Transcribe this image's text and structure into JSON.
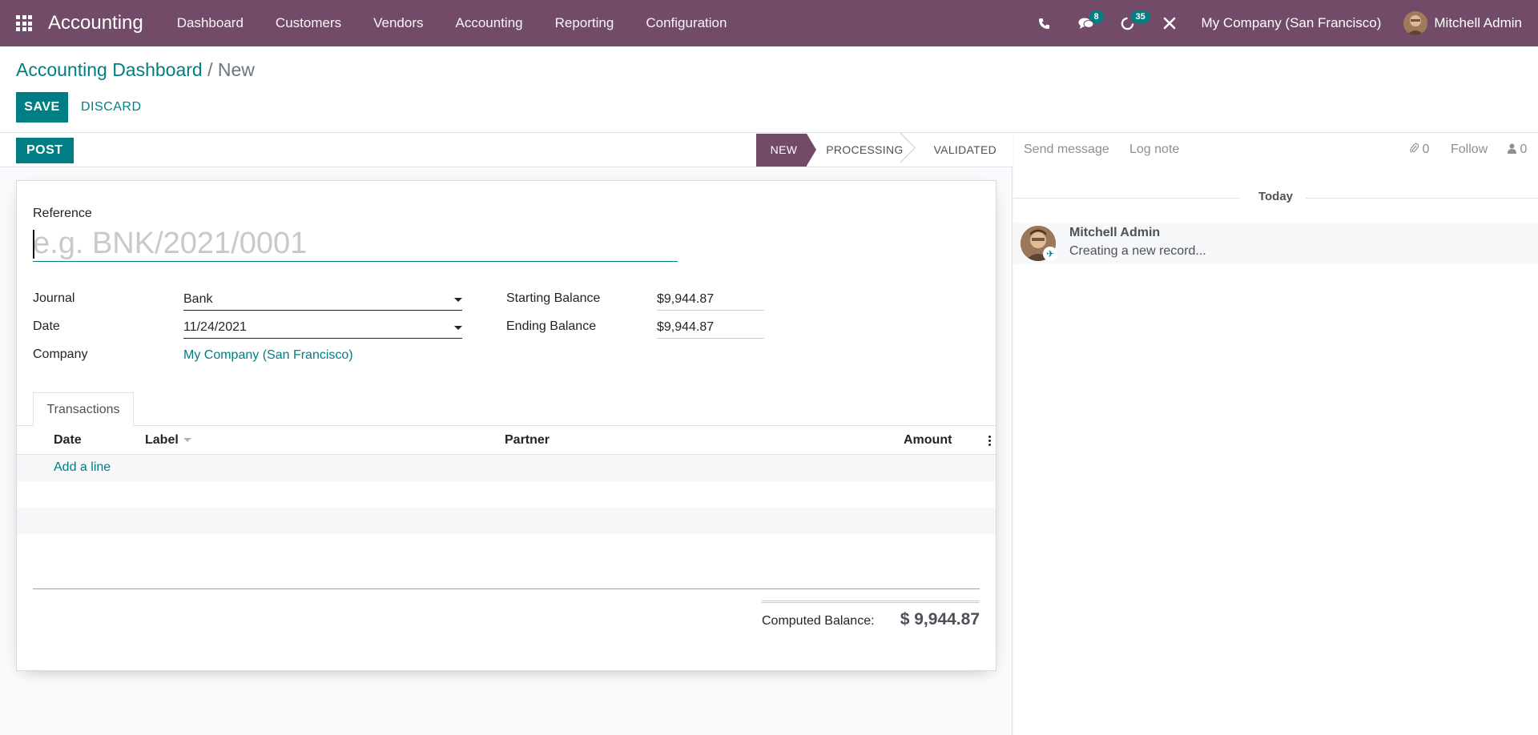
{
  "navbar": {
    "brand": "Accounting",
    "menu": [
      "Dashboard",
      "Customers",
      "Vendors",
      "Accounting",
      "Reporting",
      "Configuration"
    ],
    "messages_badge": "8",
    "activities_badge": "35",
    "company": "My Company (San Francisco)",
    "user": "Mitchell Admin",
    "color": "#714B67"
  },
  "breadcrumb": {
    "parent": "Accounting Dashboard",
    "separator": "/",
    "current": "New"
  },
  "buttons": {
    "save": "SAVE",
    "discard": "DISCARD",
    "post": "POST"
  },
  "stages": [
    "NEW",
    "PROCESSING",
    "VALIDATED"
  ],
  "form": {
    "reference_label": "Reference",
    "reference_placeholder": "e.g. BNK/2021/0001",
    "journal_label": "Journal",
    "journal_value": "Bank",
    "date_label": "Date",
    "date_value": "11/24/2021",
    "company_label": "Company",
    "company_value": "My Company (San Francisco)",
    "starting_balance_label": "Starting Balance",
    "starting_balance_value": "$9,944.87",
    "ending_balance_label": "Ending Balance",
    "ending_balance_value": "$9,944.87"
  },
  "tab": {
    "label": "Transactions"
  },
  "table": {
    "columns": [
      "Date",
      "Label",
      "Partner",
      "Amount"
    ],
    "add_line": "Add a line"
  },
  "totals": {
    "label": "Computed Balance:",
    "value": "$ 9,944.87"
  },
  "chatter": {
    "send_message": "Send message",
    "log_note": "Log note",
    "attachments": "0",
    "follow": "Follow",
    "followers": "0",
    "date_separator": "Today",
    "message_author": "Mitchell Admin",
    "message_body": "Creating a new record..."
  },
  "colors": {
    "accent": "#017e84",
    "brand": "#714B67"
  }
}
